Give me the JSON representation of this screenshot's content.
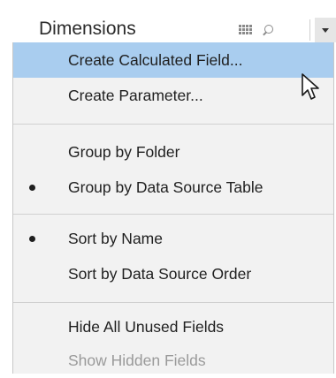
{
  "panel": {
    "title": "Dimensions",
    "icons": [
      "list-view-icon",
      "search-icon",
      "chevron-down-icon"
    ]
  },
  "menu": {
    "items": [
      {
        "label": "Create Calculated Field...",
        "highlighted": true,
        "checked": false,
        "enabled": true
      },
      {
        "label": "Create Parameter...",
        "highlighted": false,
        "checked": false,
        "enabled": true
      },
      {
        "label": "Group by Folder",
        "highlighted": false,
        "checked": false,
        "enabled": true
      },
      {
        "label": "Group by Data Source Table",
        "highlighted": false,
        "checked": true,
        "enabled": true
      },
      {
        "label": "Sort by Name",
        "highlighted": false,
        "checked": true,
        "enabled": true
      },
      {
        "label": "Sort by Data Source Order",
        "highlighted": false,
        "checked": false,
        "enabled": true
      },
      {
        "label": "Hide All Unused Fields",
        "highlighted": false,
        "checked": false,
        "enabled": true
      },
      {
        "label": "Show Hidden Fields",
        "highlighted": false,
        "checked": false,
        "enabled": false
      }
    ]
  },
  "colors": {
    "highlight": "#a9cdef",
    "menu_background": "#f2f2f2",
    "disabled_text": "#9a9a9a"
  }
}
